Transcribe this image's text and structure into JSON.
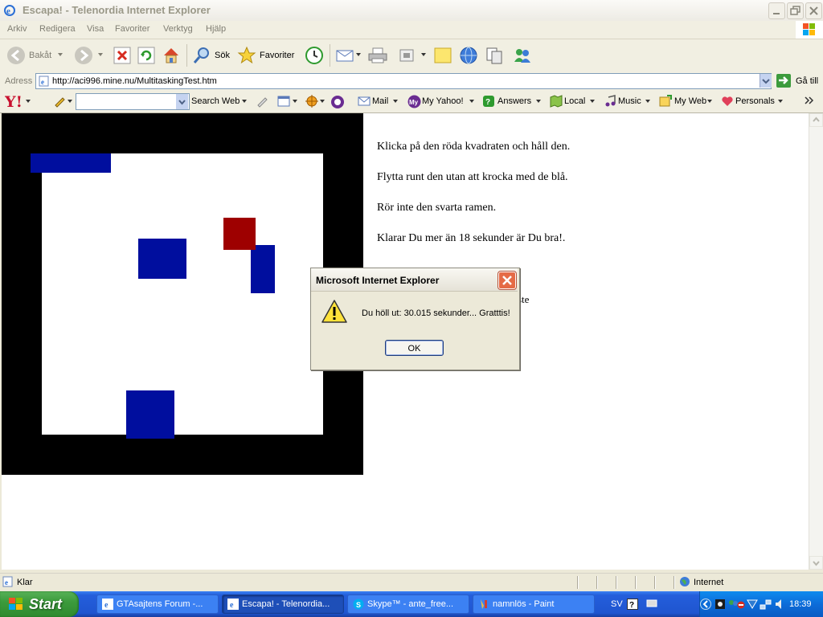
{
  "window": {
    "title": "Escapa! - Telenordia Internet Explorer"
  },
  "menu": [
    "Arkiv",
    "Redigera",
    "Visa",
    "Favoriter",
    "Verktyg",
    "Hjälp"
  ],
  "toolbar": {
    "back_label": "Bakåt",
    "search_label": "Sök",
    "favorites_label": "Favoriter"
  },
  "address": {
    "label": "Adress",
    "url": "http://aci996.mine.nu/MultitaskingTest.htm",
    "go_label": "Gå till"
  },
  "yahoo": {
    "search_web": "Search Web",
    "mail": "Mail",
    "my_yahoo": "My Yahoo!",
    "answers": "Answers",
    "local": "Local",
    "music": "Music",
    "my_web": "My Web",
    "personals": "Personals"
  },
  "page": {
    "instructions": [
      "Klicka på den röda kvadraten och håll den.",
      "Flytta runt den utan att krocka med de blå.",
      "Rör inte den svarta ramen.",
      "Klarar Du mer än 18 sekunder är Du bra!."
    ],
    "partial_line_1": ".",
    "partial_line_2": "ste"
  },
  "dialog": {
    "title": "Microsoft Internet Explorer",
    "message": "Du höll ut: 30.015 sekunder... Gratttis!",
    "ok_label": "OK"
  },
  "status": {
    "text": "Klar",
    "zone": "Internet"
  },
  "taskbar": {
    "start_label": "Start",
    "tasks": [
      {
        "label": "GTAsajtens Forum -..."
      },
      {
        "label": "Escapa! - Telenordia..."
      },
      {
        "label": "Skype™ - ante_free..."
      },
      {
        "label": "namnlös - Paint"
      }
    ],
    "language": "SV",
    "clock": "18:39"
  },
  "colors": {
    "game_frame": "#000000",
    "blue_block": "#000E9E",
    "red_block": "#9E0000"
  }
}
